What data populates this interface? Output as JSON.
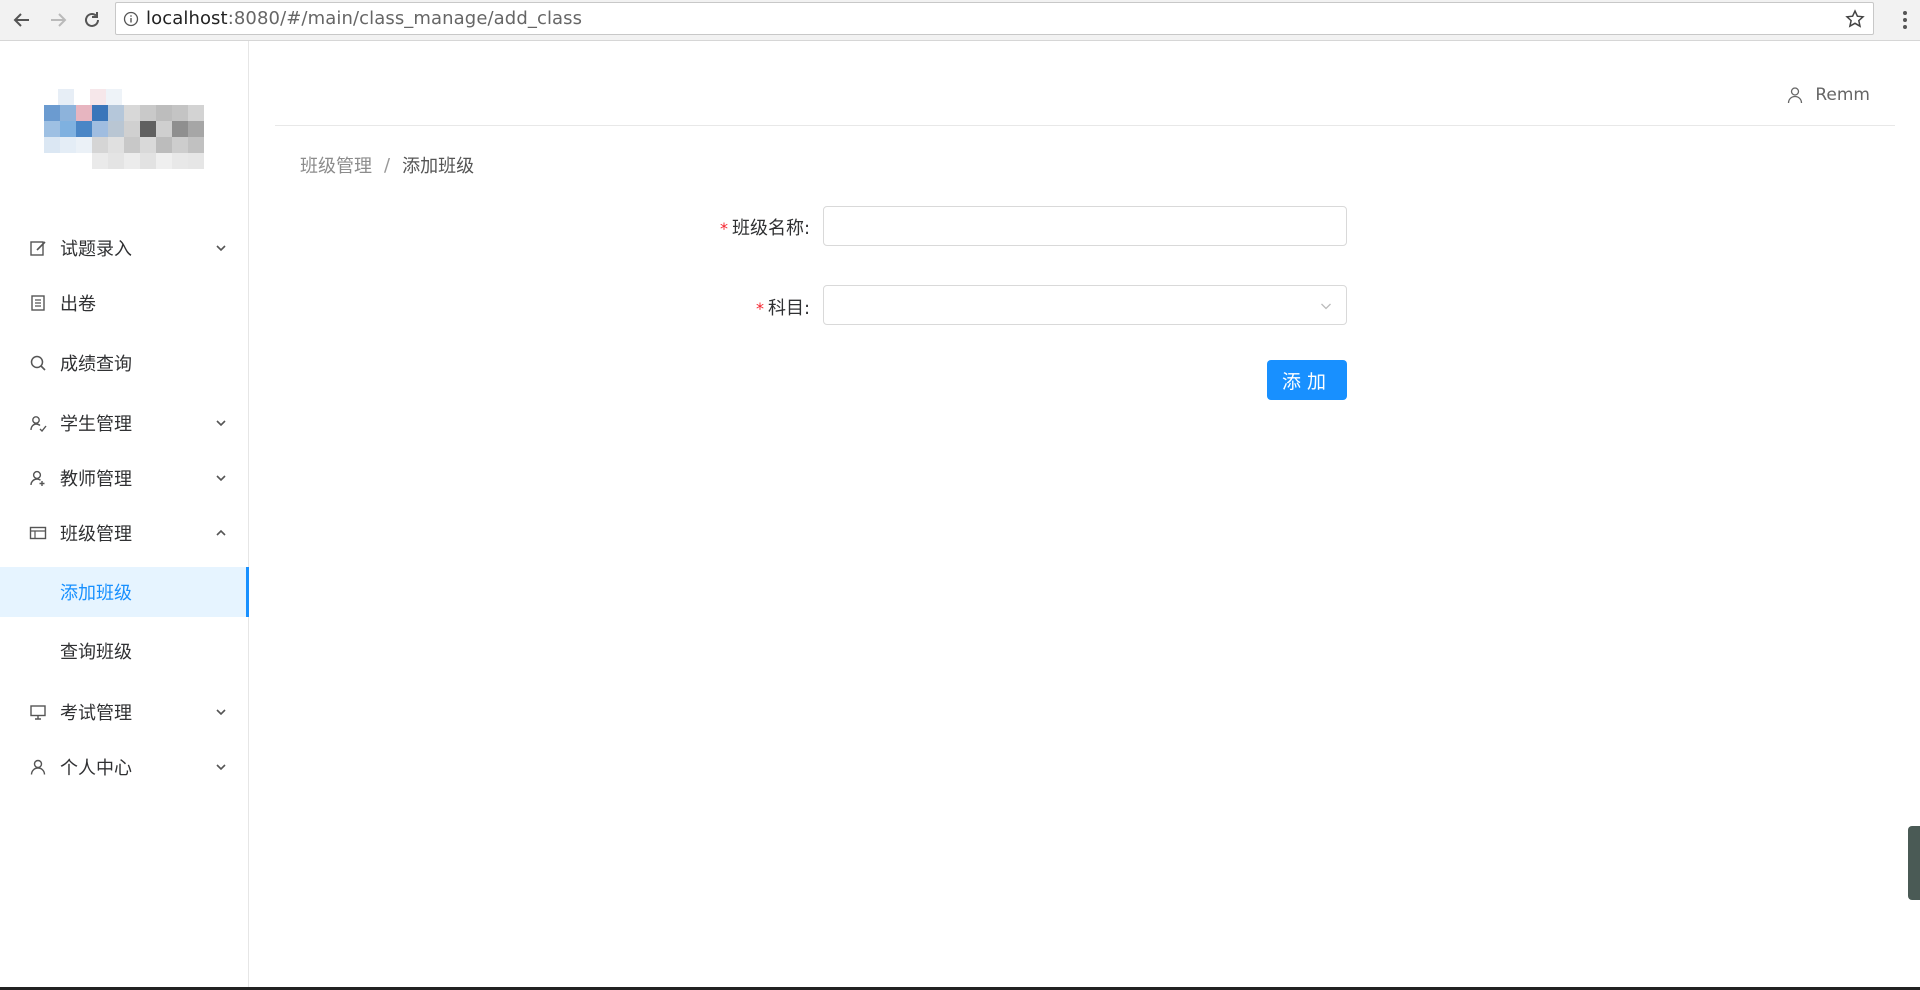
{
  "browser": {
    "url_host": "localhost",
    "url_rest": ":8080/#/main/class_manage/add_class"
  },
  "sidebar": {
    "items": [
      {
        "label": "试题录入",
        "icon": "edit-icon",
        "arrow": "down"
      },
      {
        "label": "出卷",
        "icon": "document-icon",
        "arrow": ""
      },
      {
        "label": "成绩查询",
        "icon": "search-icon",
        "arrow": ""
      },
      {
        "label": "学生管理",
        "icon": "student-icon",
        "arrow": "down"
      },
      {
        "label": "教师管理",
        "icon": "teacher-icon",
        "arrow": "down"
      },
      {
        "label": "班级管理",
        "icon": "class-icon",
        "arrow": "up"
      }
    ],
    "sub_items": [
      {
        "label": "添加班级",
        "active": true
      },
      {
        "label": "查询班级",
        "active": false
      }
    ],
    "items_after": [
      {
        "label": "考试管理",
        "icon": "monitor-icon",
        "arrow": "down"
      },
      {
        "label": "个人中心",
        "icon": "user-icon",
        "arrow": "down"
      }
    ]
  },
  "header": {
    "username": "Remm"
  },
  "breadcrumb": {
    "parent": "班级管理",
    "separator": "/",
    "current": "添加班级"
  },
  "form": {
    "class_name_label": "班级名称:",
    "class_name_value": "",
    "subject_label": "科目:",
    "subject_value": "",
    "submit_label": "添加"
  },
  "colors": {
    "primary": "#1890ff",
    "required": "#f5222d",
    "active_bg": "#e6f4ff"
  }
}
